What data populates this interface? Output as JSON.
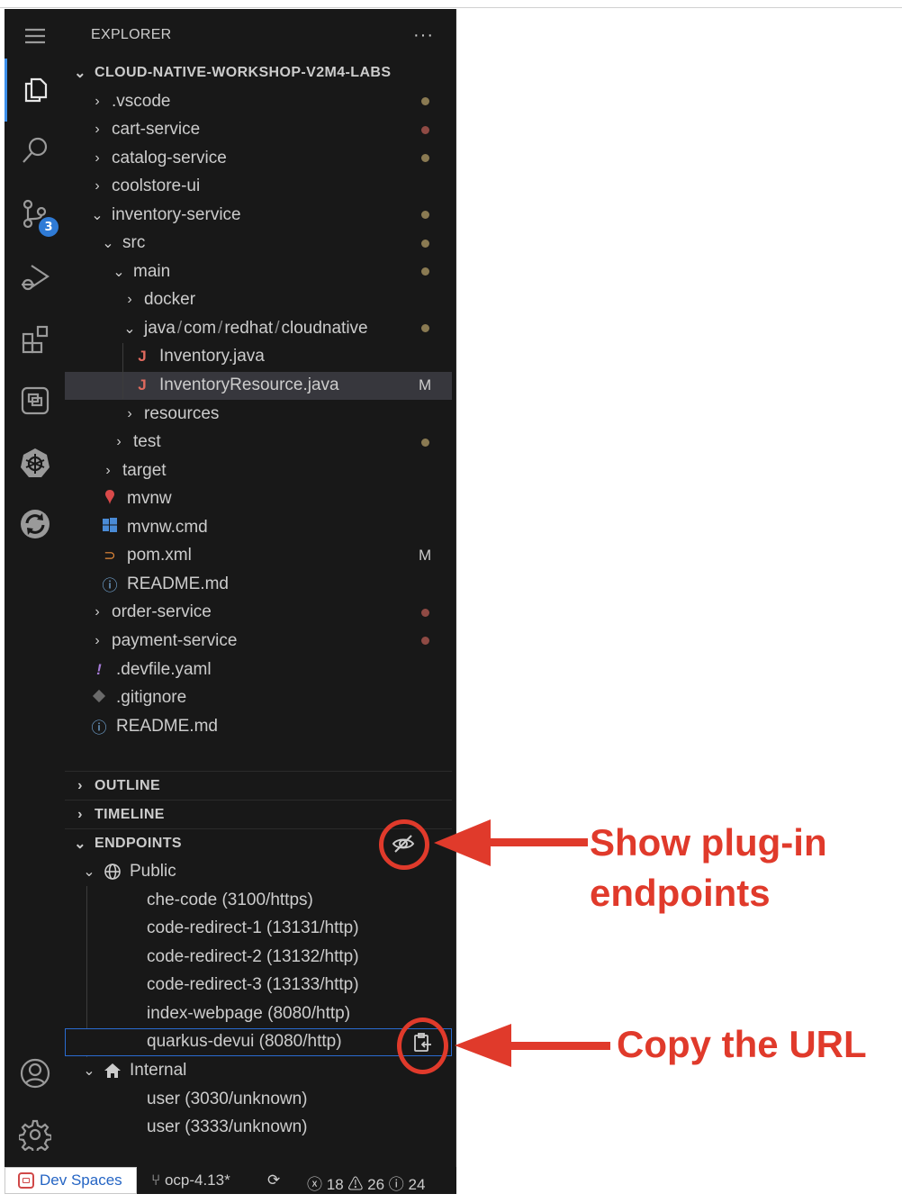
{
  "explorer": {
    "title": "EXPLORER",
    "more_label": "···",
    "root": "CLOUD-NATIVE-WORKSHOP-V2M4-LABS",
    "tree": [
      {
        "label": ".vscode",
        "chevron": "›",
        "status": "dot"
      },
      {
        "label": "cart-service",
        "chevron": "›",
        "status": "dot"
      },
      {
        "label": "catalog-service",
        "chevron": "›",
        "status": "dot"
      },
      {
        "label": "coolstore-ui",
        "chevron": "›"
      },
      {
        "label": "inventory-service",
        "chevron": "⌄",
        "status": "dot"
      },
      {
        "label": "src",
        "chevron": "⌄",
        "status": "dot"
      },
      {
        "label": "main",
        "chevron": "⌄",
        "status": "dot"
      },
      {
        "label": "docker",
        "chevron": "›"
      },
      {
        "label_parts": [
          "java",
          "/",
          "com",
          "/",
          "redhat",
          "/",
          "cloudnative"
        ],
        "chevron": "⌄",
        "status": "dot"
      },
      {
        "label": "Inventory.java",
        "icon": "J"
      },
      {
        "label": "InventoryResource.java",
        "icon": "J",
        "status": "M"
      },
      {
        "label": "resources",
        "chevron": "›"
      },
      {
        "label": "test",
        "chevron": "›",
        "status": "dot"
      },
      {
        "label": "target",
        "chevron": "›"
      },
      {
        "label": "mvnw",
        "icon": "pin"
      },
      {
        "label": "mvnw.cmd",
        "icon": "windows"
      },
      {
        "label": "pom.xml",
        "icon": "rss",
        "status": "M"
      },
      {
        "label": "README.md",
        "icon": "info"
      },
      {
        "label": "order-service",
        "chevron": "›",
        "status": "dot"
      },
      {
        "label": "payment-service",
        "chevron": "›",
        "status": "dot"
      },
      {
        "label": ".devfile.yaml",
        "icon": "!"
      },
      {
        "label": ".gitignore",
        "icon": "git"
      },
      {
        "label": "README.md",
        "icon": "info"
      }
    ]
  },
  "sections": {
    "outline": "OUTLINE",
    "timeline": "TIMELINE",
    "endpoints": "ENDPOINTS"
  },
  "endpoints": {
    "public_label": "Public",
    "public": [
      "che-code (3100/https)",
      "code-redirect-1 (13131/http)",
      "code-redirect-2 (13132/http)",
      "code-redirect-3 (13133/http)",
      "index-webpage (8080/http)",
      "quarkus-devui (8080/http)"
    ],
    "internal_label": "Internal",
    "internal": [
      "user (3030/unknown)",
      "user (3333/unknown)"
    ]
  },
  "activity_bar": {
    "scm_badge": "3",
    "icons": [
      "menu-icon",
      "explorer-icon",
      "search-icon",
      "source-control-icon",
      "run-debug-icon",
      "extensions-icon",
      "remote-explorer-icon",
      "kubernetes-icon",
      "sync-icon",
      "account-icon",
      "settings-icon"
    ]
  },
  "statusbar": {
    "remote": "Dev Spaces",
    "branch": "ocp-4.13*",
    "errors": "18",
    "warnings": "26",
    "info": "24"
  },
  "annotations": {
    "show_plugin_line1": "Show plug-in",
    "show_plugin_line2": "endpoints",
    "copy_url": "Copy the URL"
  },
  "colors": {
    "modified": "#e2c08d",
    "deleted": "#f0786b",
    "annotation": "#e03a2b",
    "accent": "#3b8eea"
  }
}
